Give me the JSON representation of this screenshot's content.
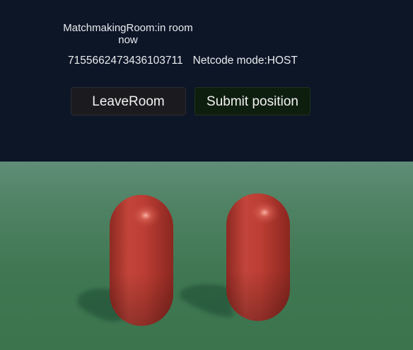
{
  "hud": {
    "status_line1": "MatchmakingRoom:in room",
    "status_line2": "now",
    "room_id": "7155662473436103711",
    "netcode_mode": "Netcode mode:HOST"
  },
  "buttons": {
    "leave_label": "LeaveRoom",
    "submit_label": "Submit position"
  },
  "colors": {
    "panel_bg": "#0d1627",
    "ground": "#3f7752",
    "player_capsule": "#b8392e"
  }
}
